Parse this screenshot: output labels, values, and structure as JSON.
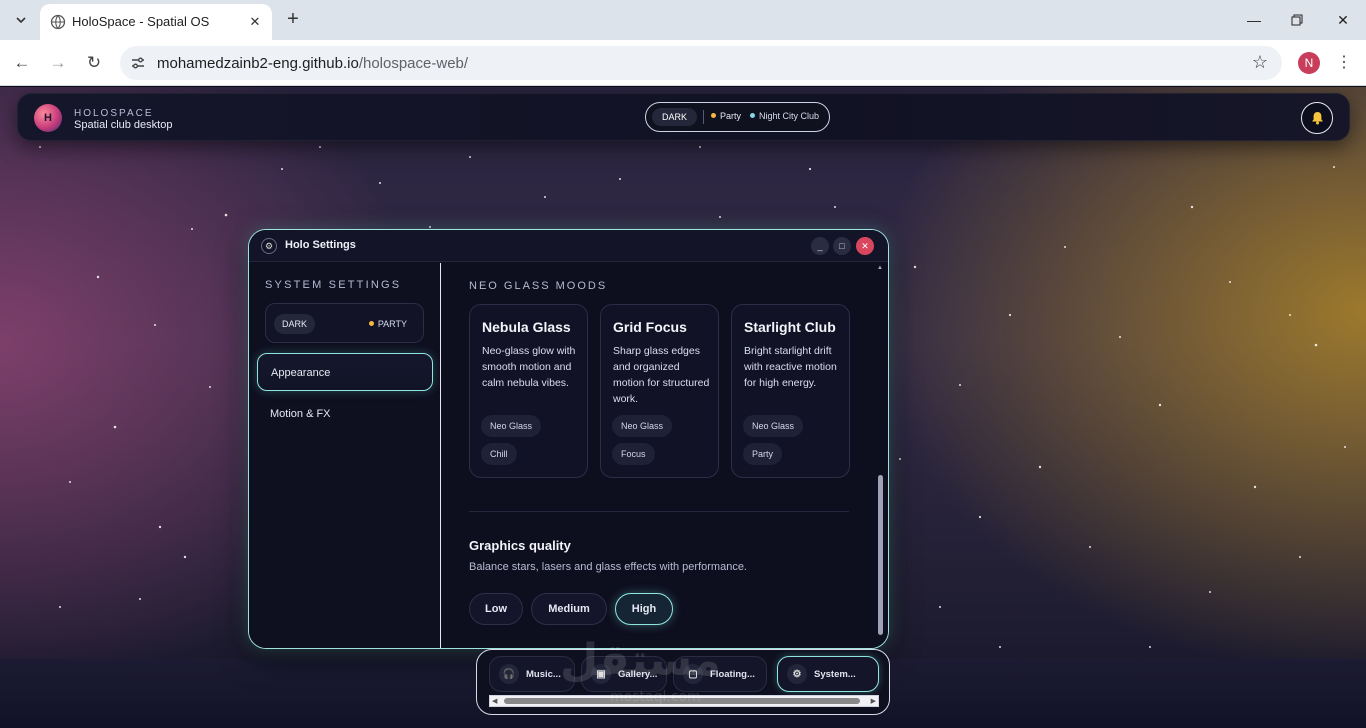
{
  "browser": {
    "tab_title": "HoloSpace - Spatial OS",
    "url_domain": "mohamedzainb2-eng.github.io",
    "url_path": "/holospace-web/",
    "profile_initial": "N"
  },
  "topbar": {
    "logo_letter": "H",
    "brand": "HOLOSPACE",
    "subtitle": "Spatial club desktop",
    "mode_label": "DARK",
    "party_label": "Party",
    "club_label": "Night City Club",
    "party_color": "#f5b841",
    "club_color": "#7fd8e8"
  },
  "window": {
    "title": "Holo Settings",
    "sidebar": {
      "heading": "SYSTEM SETTINGS",
      "mode_dark": "DARK",
      "mode_party": "PARTY",
      "items": [
        {
          "label": "Appearance",
          "active": true
        },
        {
          "label": "Motion & FX",
          "active": false
        }
      ]
    },
    "content": {
      "heading": "NEO GLASS MOODS",
      "cards": [
        {
          "title": "Nebula Glass",
          "desc": "Neo-glass glow with smooth motion and calm nebula vibes.",
          "chips": [
            "Neo Glass",
            "Chill"
          ]
        },
        {
          "title": "Grid Focus",
          "desc": "Sharp glass edges and organized motion for structured work.",
          "chips": [
            "Neo Glass",
            "Focus"
          ]
        },
        {
          "title": "Starlight Club",
          "desc": "Bright starlight drift with reactive motion for high energy.",
          "chips": [
            "Neo Glass",
            "Party"
          ]
        }
      ],
      "graphics_title": "Graphics quality",
      "graphics_desc": "Balance stars, lasers and glass effects with performance.",
      "quality_options": [
        "Low",
        "Medium",
        "High"
      ],
      "quality_selected": "High"
    }
  },
  "dock": {
    "items": [
      {
        "label": "Music...",
        "icon": "headphones-icon"
      },
      {
        "label": "Gallery...",
        "icon": "image-icon"
      },
      {
        "label": "Floating...",
        "icon": "window-icon"
      },
      {
        "label": "System...",
        "icon": "gear-icon"
      }
    ]
  },
  "watermark": {
    "text": "مستقل",
    "sub": "mostaql.com"
  },
  "colors": {
    "accent": "#8ee7df",
    "close": "#d9475e"
  }
}
